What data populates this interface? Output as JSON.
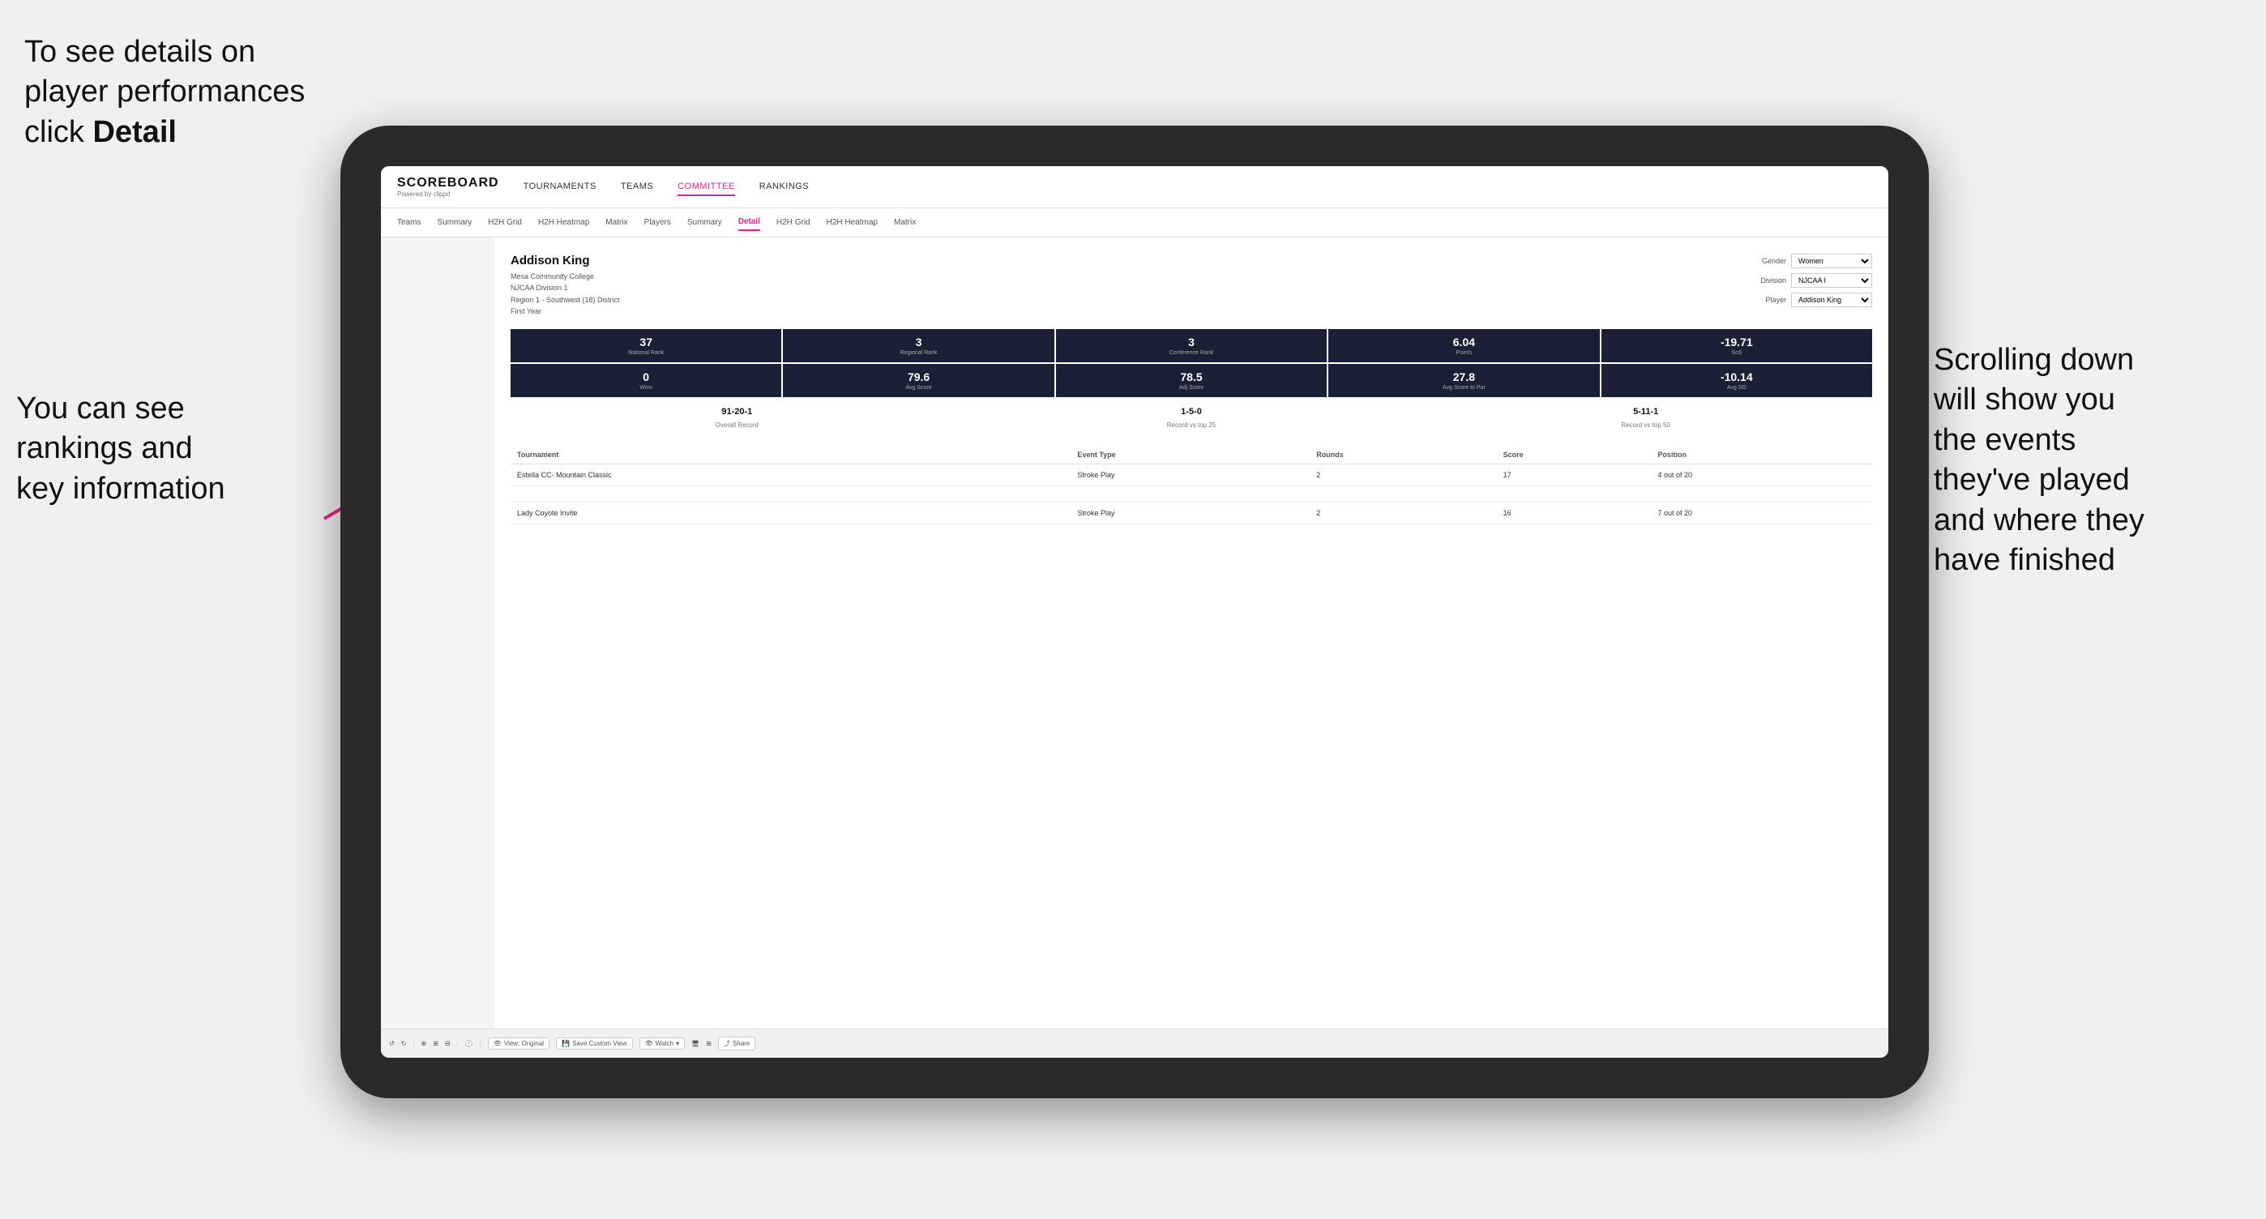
{
  "annotations": {
    "topleft": {
      "line1": "To see details on",
      "line2": "player performances",
      "line3_normal": "click ",
      "line3_bold": "Detail"
    },
    "bottomleft": {
      "line1": "You can see",
      "line2": "rankings and",
      "line3": "key information"
    },
    "right": {
      "line1": "Scrolling down",
      "line2": "will show you",
      "line3": "the events",
      "line4": "they've played",
      "line5": "and where they",
      "line6": "have finished"
    }
  },
  "app": {
    "logo_title": "SCOREBOARD",
    "logo_sub": "Powered by clippd",
    "nav": [
      {
        "label": "TOURNAMENTS",
        "active": false
      },
      {
        "label": "TEAMS",
        "active": false
      },
      {
        "label": "COMMITTEE",
        "active": true
      },
      {
        "label": "RANKINGS",
        "active": false
      }
    ],
    "subnav": [
      {
        "label": "Teams",
        "active": false
      },
      {
        "label": "Summary",
        "active": false
      },
      {
        "label": "H2H Grid",
        "active": false
      },
      {
        "label": "H2H Heatmap",
        "active": false
      },
      {
        "label": "Matrix",
        "active": false
      },
      {
        "label": "Players",
        "active": false
      },
      {
        "label": "Summary",
        "active": false
      },
      {
        "label": "Detail",
        "active": true
      },
      {
        "label": "H2H Grid",
        "active": false
      },
      {
        "label": "H2H Heatmap",
        "active": false
      },
      {
        "label": "Matrix",
        "active": false
      }
    ]
  },
  "player": {
    "name": "Addison King",
    "school": "Mesa Community College",
    "division": "NJCAA Division 1",
    "region": "Region 1 - Southwest (18) District",
    "year": "First Year",
    "gender_label": "Gender",
    "gender_value": "Women",
    "division_label": "Division",
    "division_value": "NJCAA I",
    "player_label": "Player",
    "player_value": "Addison King"
  },
  "stats_row1": [
    {
      "value": "37",
      "label": "National Rank"
    },
    {
      "value": "3",
      "label": "Regional Rank"
    },
    {
      "value": "3",
      "label": "Conference Rank"
    },
    {
      "value": "6.04",
      "label": "Points"
    },
    {
      "value": "-19.71",
      "label": "SoS"
    }
  ],
  "stats_row2": [
    {
      "value": "0",
      "label": "Wins"
    },
    {
      "value": "79.6",
      "label": "Avg Score"
    },
    {
      "value": "78.5",
      "label": "Adj Score"
    },
    {
      "value": "27.8",
      "label": "Avg Score to Par"
    },
    {
      "value": "-10.14",
      "label": "Avg SG"
    }
  ],
  "records": [
    {
      "value": "91-20-1",
      "label": "Overall Record"
    },
    {
      "value": "1-5-0",
      "label": "Record vs top 25"
    },
    {
      "value": "5-11-1",
      "label": "Record vs top 50"
    }
  ],
  "table": {
    "headers": [
      "Tournament",
      "",
      "Event Type",
      "Rounds",
      "Score",
      "Position"
    ],
    "rows": [
      {
        "tournament": "Estella CC- Mountain Classic",
        "event_type": "Stroke Play",
        "rounds": "2",
        "score": "17",
        "position": "4 out of 20"
      },
      {
        "tournament": "Lady Coyote Invite",
        "event_type": "Stroke Play",
        "rounds": "2",
        "score": "16",
        "position": "7 out of 20"
      }
    ]
  },
  "toolbar": {
    "view_original": "View: Original",
    "save_custom": "Save Custom View",
    "watch": "Watch",
    "share": "Share"
  }
}
